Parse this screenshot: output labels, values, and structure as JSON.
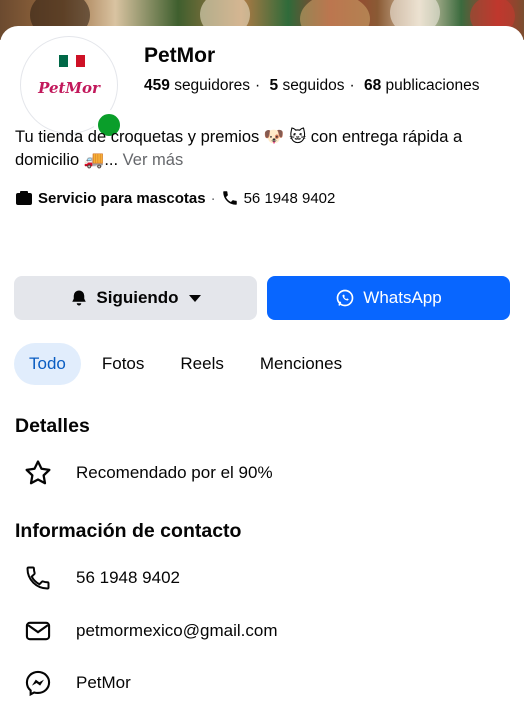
{
  "profile": {
    "name": "PetMor",
    "logo_text": "PetMor",
    "followers_count": "459",
    "followers_label": "seguidores",
    "following_count": "5",
    "following_label": "seguidos",
    "posts_count": "68",
    "posts_label": "publicaciones",
    "bio": "Tu tienda de croquetas y premios 🐶 🐱 con entrega rápida a domicilio 🚚...",
    "see_more": "Ver más",
    "category": "Servicio para mascotas",
    "phone_meta": "56 1948 9402",
    "status_color": "#0a9e2a"
  },
  "actions": {
    "following_label": "Siguiendo",
    "whatsapp_label": "WhatsApp",
    "accent": "#0866ff"
  },
  "tabs": [
    {
      "label": "Todo",
      "active": true
    },
    {
      "label": "Fotos",
      "active": false
    },
    {
      "label": "Reels",
      "active": false
    },
    {
      "label": "Menciones",
      "active": false
    }
  ],
  "details": {
    "title": "Detalles",
    "recommended": "Recomendado por el 90%"
  },
  "contact": {
    "title": "Información de contacto",
    "phone": "56 1948 9402",
    "email": "petmormexico@gmail.com",
    "messenger": "PetMor"
  }
}
